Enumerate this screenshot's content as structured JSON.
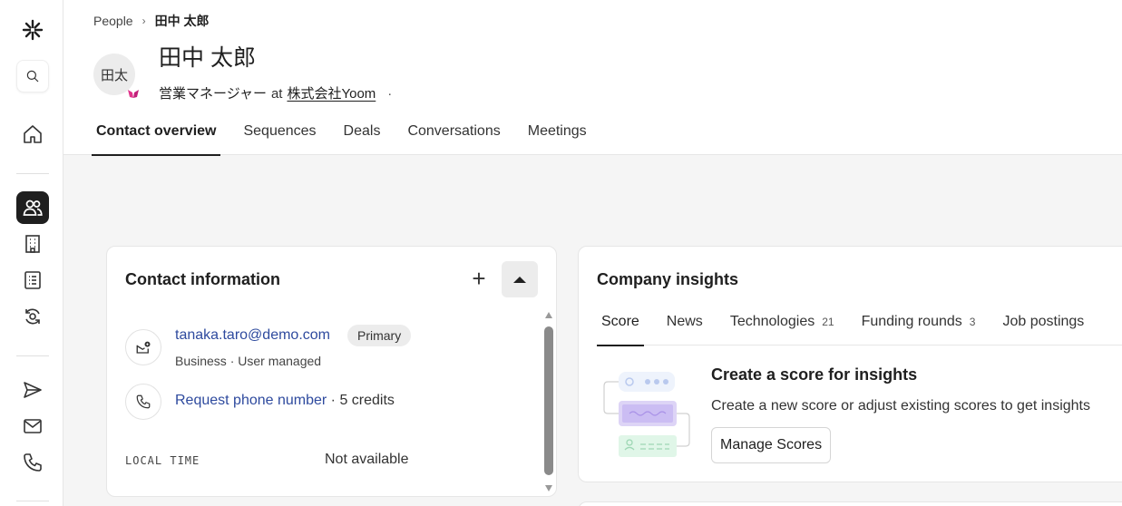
{
  "breadcrumb": {
    "parent": "People",
    "current": "田中 太郎"
  },
  "person": {
    "avatar_initials": "田太",
    "name": "田中 太郎",
    "role": "営業マネージャー",
    "at": "at",
    "company": "株式会社Yoom",
    "more": "·"
  },
  "tabs": [
    "Contact overview",
    "Sequences",
    "Deals",
    "Conversations",
    "Meetings"
  ],
  "contact_info": {
    "title": "Contact information",
    "add": "+",
    "email": "tanaka.taro@demo.com",
    "email_badge": "Primary",
    "email_meta": "Business · User managed",
    "phone_link": "Request phone number",
    "phone_credits": " · 5 credits",
    "local_time_label": "LOCAL TIME",
    "local_time_value": "Not available"
  },
  "insights": {
    "title": "Company insights",
    "tabs": [
      {
        "label": "Score",
        "count": ""
      },
      {
        "label": "News",
        "count": ""
      },
      {
        "label": "Technologies",
        "count": "21"
      },
      {
        "label": "Funding rounds",
        "count": "3"
      },
      {
        "label": "Job postings",
        "count": ""
      }
    ],
    "heading": "Create a score for insights",
    "description": "Create a new score or adjust existing scores to get insights",
    "button": "Manage Scores"
  },
  "colors": {
    "link": "#2e4a9e",
    "active_rail": "#1f1f1f",
    "accent_pink": "#e0338a"
  },
  "rail_icons": [
    "logo-icon",
    "search-icon",
    "home-icon",
    "people-icon",
    "building-icon",
    "list-icon",
    "sync-icon",
    "send-icon",
    "mail-icon",
    "phone-icon"
  ]
}
